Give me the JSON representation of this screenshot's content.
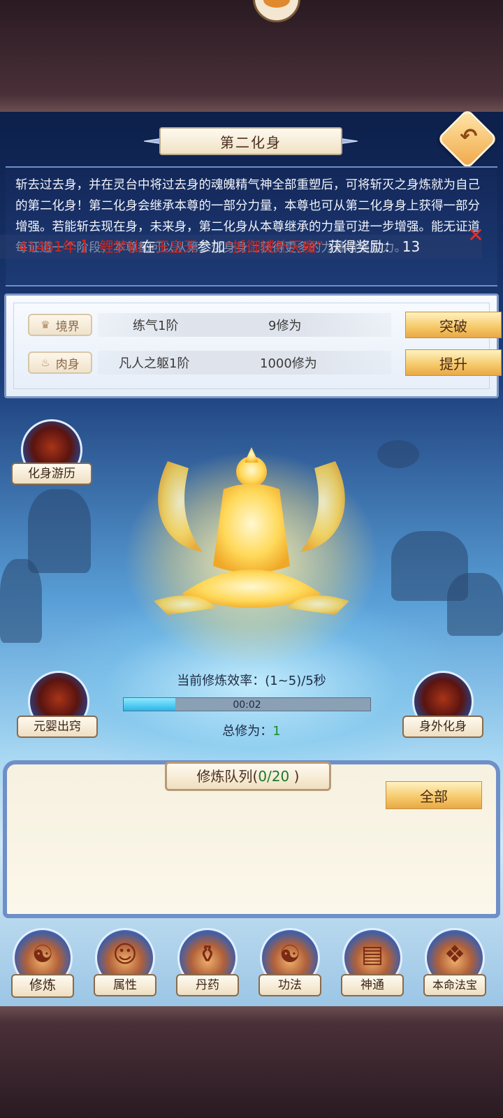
{
  "header": {
    "title": "第二化身",
    "back_icon": "back-arrow-icon"
  },
  "description": {
    "text": "斩去过去身，并在灵台中将过去身的魂魄精气神全部重塑后，可将斩灭之身炼就为自己的第二化身！第二化身会继承本尊的一部分力量，本尊也可从第二化身身上获得一部分增强。若能斩去现在身，未来身，第二化身从本尊继承的力量可进一步增强。能无证道每证道一个阶段，本尊都可以从第二化身身上获得更多的力量增强实力。"
  },
  "broadcast": {
    "prefix": "41481年",
    "bracket": "】",
    "player": "鲤梦仙",
    "mid1": "在",
    "place": "玉皇天",
    "mid2": "参加",
    "event": "“抵御域外天魔”",
    "mid3": "获得奖励：",
    "reward": "13"
  },
  "stats": {
    "realm": {
      "tag": "境界",
      "name": "练气1阶",
      "value": "9修为",
      "button": "突破"
    },
    "body": {
      "tag": "肉身",
      "name": "凡人之躯1阶",
      "value": "1000修为",
      "button": "提升"
    }
  },
  "side_actions": {
    "travel": "化身游历",
    "yuanying": "元婴出窍",
    "external": "身外化身"
  },
  "cultivation": {
    "rate_label": "当前修炼效率：(1~5)/5秒",
    "progress": 0.21,
    "timer": "00:02",
    "total_label": "总修为：",
    "total_value": "1"
  },
  "queue": {
    "title": "修炼队列(",
    "count": "0/20",
    "title_end": " )",
    "all_button": "全部"
  },
  "nav": [
    {
      "label": "修炼",
      "icon": "meditation-icon",
      "glyph": "☯"
    },
    {
      "label": "属性",
      "icon": "character-icon",
      "glyph": "☺"
    },
    {
      "label": "丹药",
      "icon": "pill-cauldron-icon",
      "glyph": "⚱"
    },
    {
      "label": "功法",
      "icon": "scroll-icon",
      "glyph": "☯"
    },
    {
      "label": "神通",
      "icon": "book-icon",
      "glyph": "▤"
    },
    {
      "label": "本命法宝",
      "icon": "treasure-icon",
      "glyph": "❖"
    }
  ],
  "colors": {
    "accent_gold": "#f5c868",
    "broadcast_red": "#d4241c",
    "count_green": "#1a7a2a",
    "panel_border": "#6f8fc8"
  }
}
